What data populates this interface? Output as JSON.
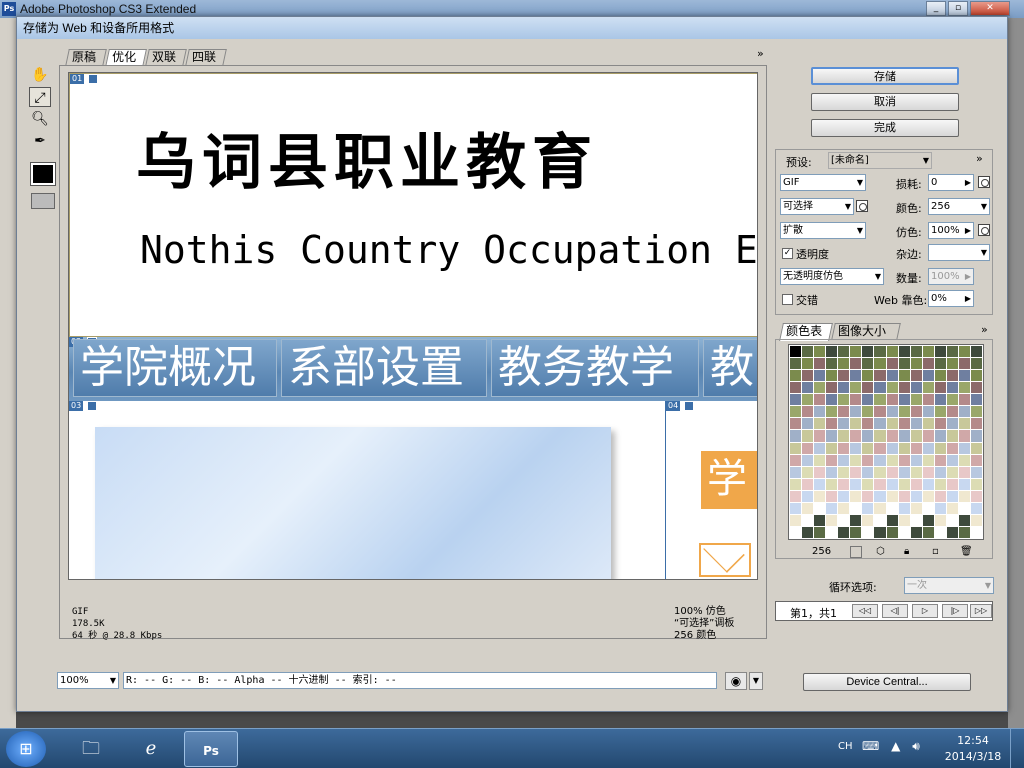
{
  "ps_window": {
    "title": "Adobe Photoshop CS3 Extended",
    "logo": "Ps"
  },
  "dialog": {
    "title": "存储为 Web 和设备所用格式"
  },
  "tabs": [
    "原稿",
    "优化",
    "双联",
    "四联"
  ],
  "tabs_more": "»",
  "canvas": {
    "title_cn": "乌词县职业教育",
    "title_en": "Nothis Country Occupation E",
    "nav": [
      "学院概况",
      "系部设置",
      "教务教学",
      "教"
    ],
    "orange_char": "学",
    "slices": [
      "01",
      "02",
      "03",
      "04"
    ]
  },
  "info": {
    "format": "GIF",
    "size": "178.5K",
    "time": "64 秒 @ 28.8 Kbps",
    "dither": "100% 仿色",
    "palette": "“可选择”调板",
    "colors": "256 颜色"
  },
  "buttons": {
    "save": "存储",
    "cancel": "取消",
    "done": "完成",
    "device_central": "Device Central..."
  },
  "settings": {
    "preset_label": "预设:",
    "preset_value": "[未命名]",
    "format": "GIF",
    "lossy_label": "损耗:",
    "lossy_value": "0",
    "reduction": "可选择",
    "colors_label": "颜色:",
    "colors_value": "256",
    "dither_algo": "扩散",
    "dither_label": "仿色:",
    "dither_value": "100%",
    "transparency_label": "透明度",
    "matte_label": "杂边:",
    "trans_dither": "无透明度仿色",
    "amount_label": "数量:",
    "amount_value": "100%",
    "interlaced_label": "交错",
    "websnap_label": "Web 靠色:",
    "websnap_value": "0%"
  },
  "color_tabs": [
    "颜色表",
    "图像大小"
  ],
  "palette_count": "256",
  "loop": {
    "label": "循环选项:",
    "value": "一次"
  },
  "animation": {
    "frame": "第1，共1"
  },
  "bottom": {
    "zoom": "100%",
    "pixel_info": "R: --  G: --  B: --  Alpha -- 十六进制      -- 索引: --"
  },
  "taskbar": {
    "lang": "CH",
    "time": "12:54",
    "date": "2014/3/18"
  },
  "colors": {
    "accent": "#3b6ea8",
    "nav_blue": "#5a86b3",
    "orange": "#f0a74a"
  }
}
